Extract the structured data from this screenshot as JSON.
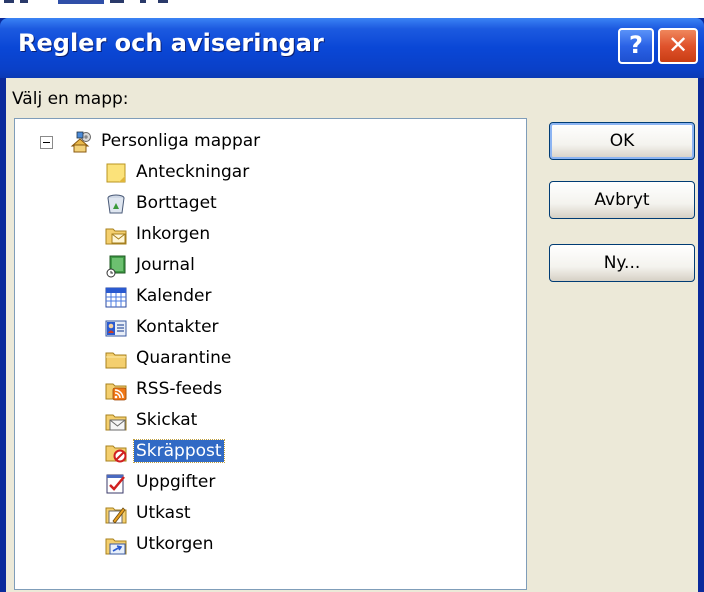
{
  "dialog": {
    "title": "Regler och aviseringar",
    "help_glyph": "?",
    "close_glyph": "✕",
    "prompt": "Välj en mapp:"
  },
  "tree": {
    "root": {
      "label": "Personliga mappar",
      "icon": "personal-folders-icon",
      "expanded": true
    },
    "items": [
      {
        "label": "Anteckningar",
        "icon": "notes-icon"
      },
      {
        "label": "Borttaget",
        "icon": "deleted-items-icon"
      },
      {
        "label": "Inkorgen",
        "icon": "inbox-icon"
      },
      {
        "label": "Journal",
        "icon": "journal-icon"
      },
      {
        "label": "Kalender",
        "icon": "calendar-icon"
      },
      {
        "label": "Kontakter",
        "icon": "contacts-icon"
      },
      {
        "label": "Quarantine",
        "icon": "folder-icon"
      },
      {
        "label": "RSS-feeds",
        "icon": "rss-feeds-icon"
      },
      {
        "label": "Skickat",
        "icon": "sent-items-icon"
      },
      {
        "label": "Skräppost",
        "icon": "junk-mail-icon",
        "selected": true
      },
      {
        "label": "Uppgifter",
        "icon": "tasks-icon"
      },
      {
        "label": "Utkast",
        "icon": "drafts-icon"
      },
      {
        "label": "Utkorgen",
        "icon": "outbox-icon"
      }
    ]
  },
  "buttons": {
    "ok": "OK",
    "cancel": "Avbryt",
    "new": "Ny..."
  },
  "colors": {
    "title_bar": "#0a47d6",
    "selection": "#316ac5",
    "dialog_face": "#ece9d8",
    "close_button": "#e0532c"
  }
}
